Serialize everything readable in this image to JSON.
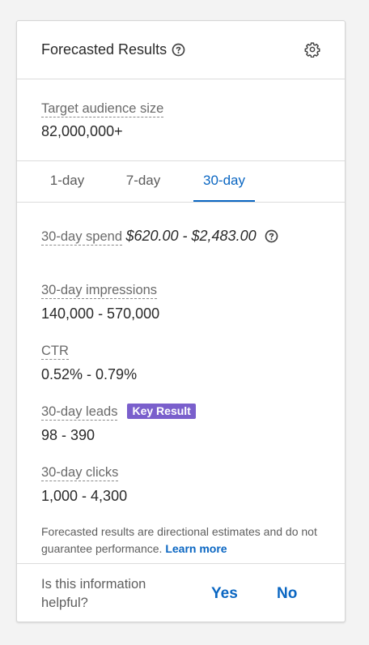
{
  "header": {
    "title": "Forecasted Results"
  },
  "audience": {
    "label": "Target audience size",
    "value": "82,000,000+"
  },
  "tabs": [
    {
      "label": "1-day",
      "active": false
    },
    {
      "label": "7-day",
      "active": false
    },
    {
      "label": "30-day",
      "active": true
    }
  ],
  "metrics": {
    "spend": {
      "label": "30-day spend",
      "value": "$620.00 - $2,483.00"
    },
    "impressions": {
      "label": "30-day impressions",
      "value": "140,000 - 570,000"
    },
    "ctr": {
      "label": "CTR",
      "value": "0.52% - 0.79%"
    },
    "leads": {
      "label": "30-day leads",
      "value": "98 - 390",
      "badge": "Key Result"
    },
    "clicks": {
      "label": "30-day clicks",
      "value": "1,000 - 4,300"
    }
  },
  "disclaimer": {
    "text": "Forecasted results are directional estimates and do not guarantee performance.",
    "link": "Learn more"
  },
  "feedback": {
    "question": "Is this information helpful?",
    "yes": "Yes",
    "no": "No"
  },
  "colors": {
    "accent": "#0a66c2",
    "badge": "#7a5fcc",
    "border": "#dcdcdc"
  },
  "icons": {
    "help": "question-circle-icon",
    "settings": "gear-icon"
  }
}
